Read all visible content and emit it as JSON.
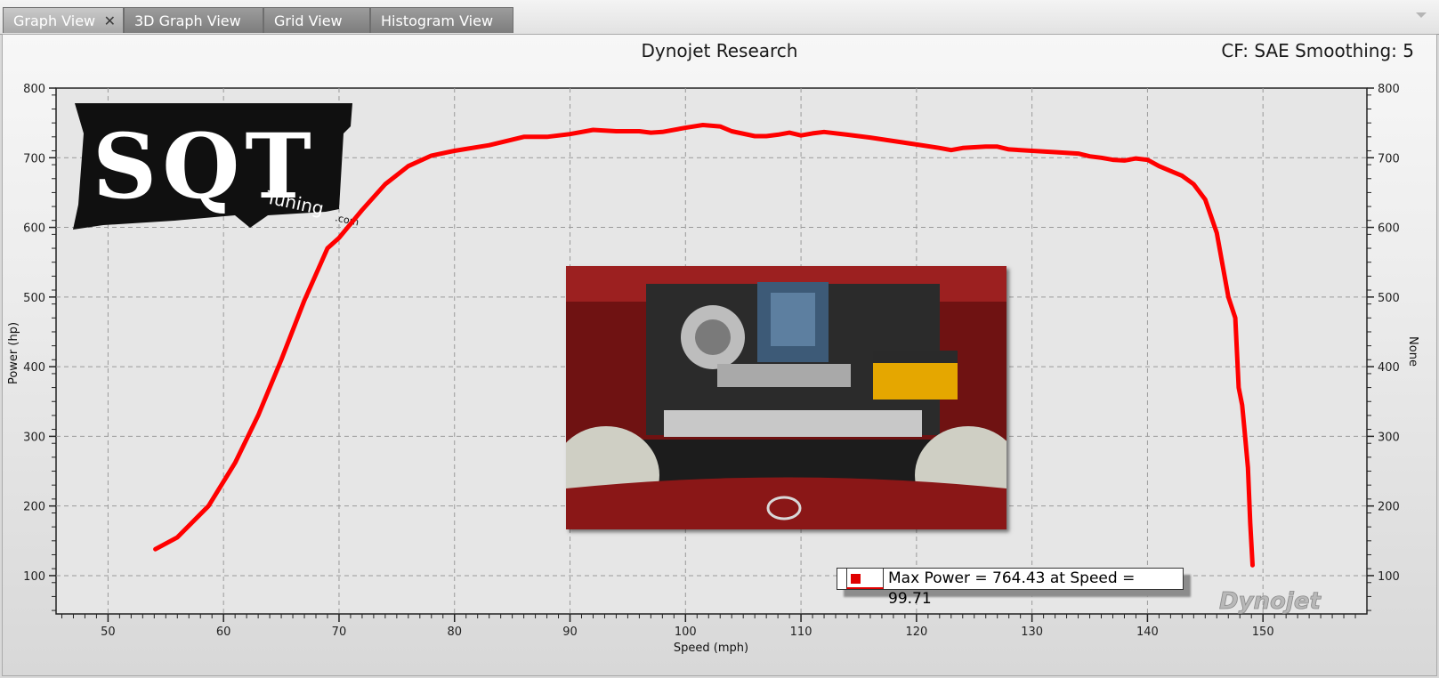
{
  "tabs": [
    {
      "label": "Graph View",
      "active": true
    },
    {
      "label": "3D Graph View",
      "active": false
    },
    {
      "label": "Grid View",
      "active": false
    },
    {
      "label": "Histogram View",
      "active": false
    }
  ],
  "header": {
    "title": "Dynojet Research",
    "cf_text": "CF: SAE Smoothing: 5"
  },
  "logo": {
    "text": "SQT",
    "subtext": "Tuning",
    "suffix": ".com"
  },
  "watermark": "Dynojet",
  "legend": {
    "text": "Max Power = 764.43 at Speed = 99.71",
    "color": "#e00000"
  },
  "colors": {
    "series": "#ff0000",
    "grid": "#9a9a9a"
  },
  "chart_data": {
    "type": "line",
    "title": "Dynojet Research",
    "xlabel": "Speed (mph)",
    "ylabel": "Power (hp)",
    "y2label": "None",
    "xlim": [
      45.5,
      159
    ],
    "ylim": [
      45,
      800
    ],
    "xticks": [
      50,
      60,
      70,
      80,
      90,
      100,
      110,
      120,
      130,
      140,
      150
    ],
    "yticks": [
      100,
      200,
      300,
      400,
      500,
      600,
      700,
      800
    ],
    "grid": true,
    "series": [
      {
        "name": "Max Power",
        "x": [
          54.1,
          56,
          58.7,
          61,
          63,
          65,
          67,
          69,
          70,
          72,
          74,
          76,
          78,
          80,
          83,
          86,
          88,
          90,
          92,
          94,
          96,
          97,
          98,
          100,
          101.5,
          103,
          104,
          106,
          107,
          108,
          109,
          110,
          111,
          112,
          114,
          116,
          118,
          120,
          122,
          123,
          124,
          126,
          127,
          128,
          130,
          132,
          134,
          135,
          136,
          137,
          138,
          139,
          140,
          141,
          142,
          143,
          144,
          145,
          146,
          147,
          147.6,
          147.9,
          148.2,
          148.4,
          148.7,
          148.9,
          149.1
        ],
        "y": [
          138,
          155,
          200,
          262,
          330,
          410,
          495,
          570,
          585,
          625,
          662,
          688,
          703,
          710,
          718,
          730,
          730,
          734,
          740,
          738,
          738,
          736,
          737,
          743,
          747,
          745,
          738,
          731,
          731,
          733,
          736,
          732,
          735,
          737,
          733,
          729,
          724,
          719,
          714,
          711,
          714,
          716,
          716,
          712,
          710,
          708,
          706,
          702,
          700,
          697,
          696,
          699,
          697,
          688,
          681,
          674,
          662,
          640,
          592,
          500,
          470,
          370,
          345,
          310,
          255,
          175,
          115
        ]
      }
    ]
  }
}
